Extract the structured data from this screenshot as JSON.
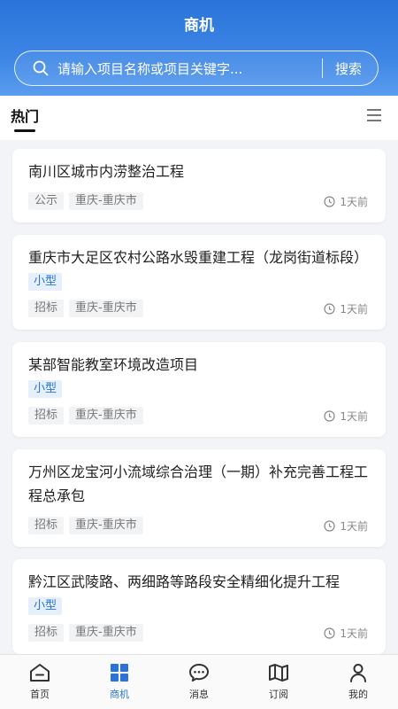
{
  "header": {
    "title": "商机",
    "search_placeholder": "请输入项目名称或项目关键字...",
    "search_button": "搜索"
  },
  "tabs": {
    "hot": "热门"
  },
  "cards": [
    {
      "title": "南川区城市内涝整治工程",
      "size": "",
      "type": "公示",
      "region": "重庆-重庆市",
      "time": "1天前"
    },
    {
      "title": "重庆市大足区农村公路水毁重建工程（龙岗街道标段）",
      "size": "小型",
      "type": "招标",
      "region": "重庆-重庆市",
      "time": "1天前"
    },
    {
      "title": "某部智能教室环境改造项目",
      "size": "小型",
      "type": "招标",
      "region": "重庆-重庆市",
      "time": "1天前"
    },
    {
      "title": "万州区龙宝河小流域综合治理（一期）补充完善工程工程总承包",
      "size": "",
      "type": "招标",
      "region": "重庆-重庆市",
      "time": "1天前"
    },
    {
      "title": "黔江区武陵路、两细路等路段安全精细化提升工程",
      "size": "小型",
      "type": "招标",
      "region": "重庆-重庆市",
      "time": "1天前"
    }
  ],
  "nav": [
    {
      "label": "首页",
      "icon": "home-icon"
    },
    {
      "label": "商机",
      "icon": "grid-icon"
    },
    {
      "label": "消息",
      "icon": "message-icon"
    },
    {
      "label": "订阅",
      "icon": "map-icon"
    },
    {
      "label": "我的",
      "icon": "user-icon"
    }
  ],
  "colors": {
    "accent": "#2a73d9",
    "header_gradient_top": "#2a73d9",
    "header_gradient_bottom": "#5a9cef",
    "tag_bg": "#e6f0fc"
  }
}
